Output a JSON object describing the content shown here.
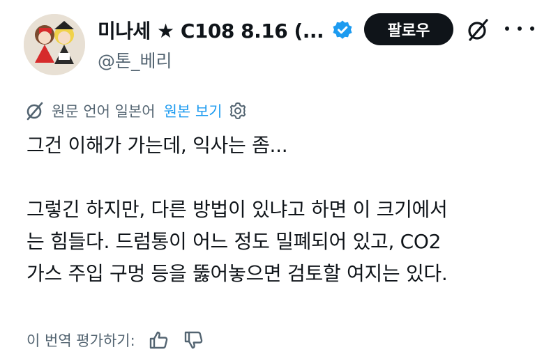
{
  "author": {
    "display_name": "미나세 ★ C108 8.16 (...",
    "handle": "@톤_베리",
    "verified": true
  },
  "actions": {
    "follow_label": "팔로우"
  },
  "translation": {
    "source_language": "원문 언어 일본어",
    "show_original": "원본 보기"
  },
  "tweet": {
    "text": "그건 이해가 가는데, 익사는 좀...\n\n그렇긴 하지만, 다른 방법이 있냐고 하면 이 크기에서\n는 힘들다. 드럼통이 어느 정도 밀폐되어 있고, CO2\n가스 주입 구멍 등을 뚫어놓으면 검토할 여지는 있다."
  },
  "rating": {
    "label": "이 번역 평가하기:"
  },
  "icons": {
    "verified": "verified-badge-icon",
    "grok": "grok-icon",
    "more": "more-icon",
    "translate": "translate-icon",
    "settings": "gear-icon",
    "thumbs_up": "thumbs-up-icon",
    "thumbs_down": "thumbs-down-icon"
  },
  "colors": {
    "text": "#0f1419",
    "secondary": "#536471",
    "link": "#1d9bf0",
    "verified": "#1d9bf0",
    "button_bg": "#0f1419"
  }
}
